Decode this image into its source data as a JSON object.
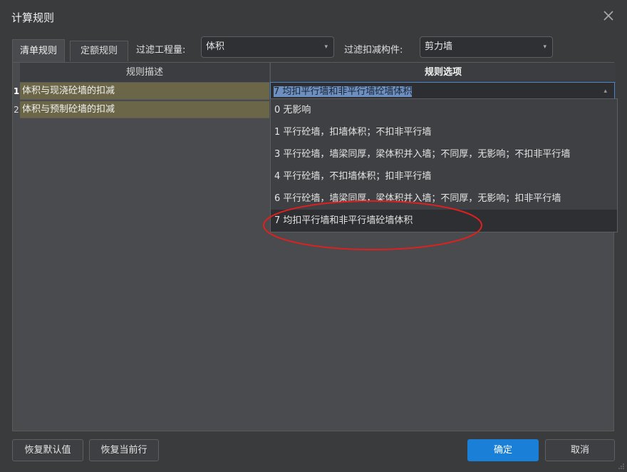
{
  "window": {
    "title": "计算规则"
  },
  "tabs": [
    {
      "label": "清单规则",
      "active": true
    },
    {
      "label": "定额规则",
      "active": false
    }
  ],
  "filters": {
    "quantity_label": "过滤工程量:",
    "quantity_value": "体积",
    "component_label": "过滤扣减构件:",
    "component_value": "剪力墙"
  },
  "grid": {
    "columns": [
      "规则描述",
      "规则选项"
    ],
    "rows": [
      {
        "num": "1",
        "desc": "体积与现浇砼墙的扣减",
        "option": "7 均扣平行墙和非平行墙砼墙体积"
      },
      {
        "num": "2",
        "desc": "体积与预制砼墙的扣减"
      }
    ]
  },
  "dropdown": {
    "options": [
      "0  无影响",
      "1 平行砼墙，扣墙体积；不扣非平行墙",
      "3 平行砼墙，墙梁同厚，梁体积并入墙；不同厚，无影响；不扣非平行墙",
      "4 平行砼墙，不扣墙体积；扣非平行墙",
      "6 平行砼墙，墙梁同厚，梁体积并入墙；不同厚，无影响；扣非平行墙",
      "7 均扣平行墙和非平行墙砼墙体积"
    ],
    "highlighted_index": 5
  },
  "buttons": {
    "restore_default": "恢复默认值",
    "restore_row": "恢复当前行",
    "ok": "确定",
    "cancel": "取消"
  },
  "colors": {
    "accent": "#1a7fd6",
    "annotation": "#e02020",
    "row_highlight": "#6b6647"
  }
}
